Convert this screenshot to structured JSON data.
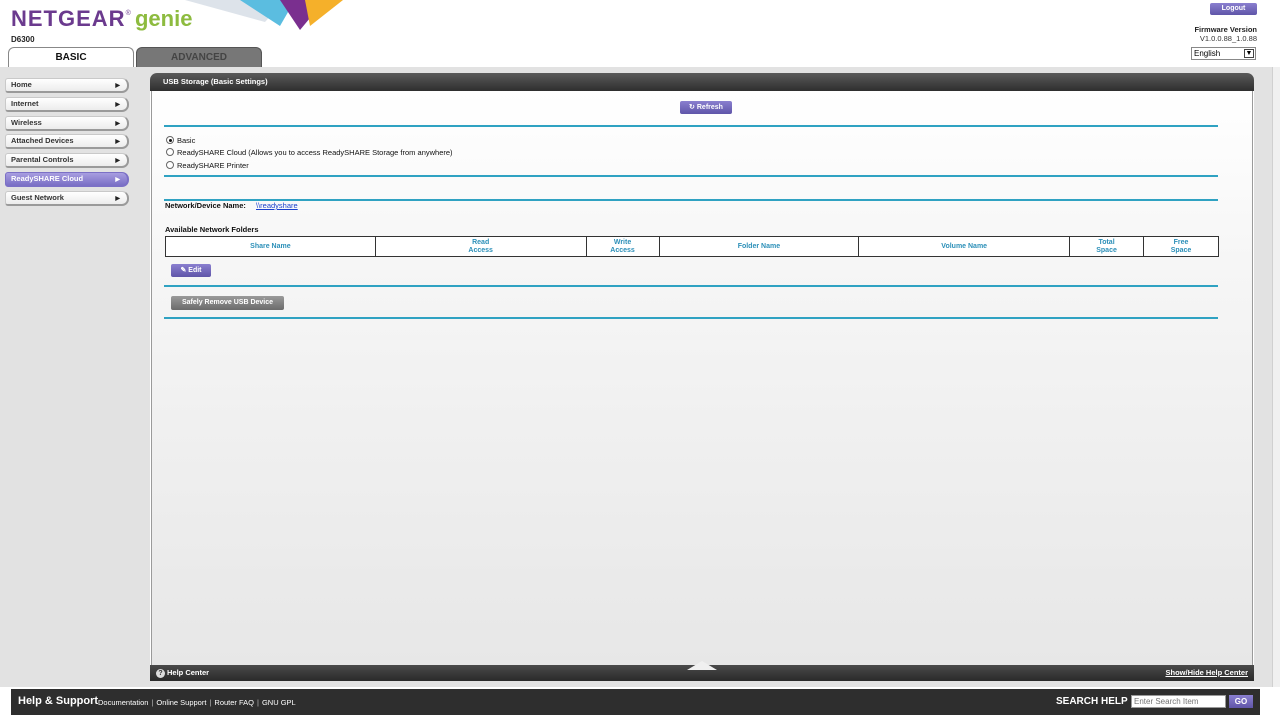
{
  "header": {
    "brand": "NETGEAR",
    "brand_mark": "®",
    "product": "genie",
    "model": "D6300",
    "tabs": [
      {
        "label": "BASIC",
        "active": true
      },
      {
        "label": "ADVANCED",
        "active": false
      }
    ],
    "logout_label": "Logout",
    "firmware_label": "Firmware Version",
    "firmware_value": "V1.0.0.88_1.0.88",
    "language": "English",
    "language_icon": "chevron-down-icon"
  },
  "sidebar": {
    "items": [
      {
        "label": "Home",
        "active": false
      },
      {
        "label": "Internet",
        "active": false
      },
      {
        "label": "Wireless",
        "active": false
      },
      {
        "label": "Attached Devices",
        "active": false
      },
      {
        "label": "Parental Controls",
        "active": false
      },
      {
        "label": "ReadySHARE Cloud",
        "active": true
      },
      {
        "label": "Guest Network",
        "active": false
      }
    ],
    "arrow_glyph": "▶"
  },
  "panel": {
    "title": "USB Storage (Basic Settings)",
    "refresh_label": "Refresh",
    "radio_options": [
      {
        "label": "Basic",
        "checked": true
      },
      {
        "label": "ReadySHARE Cloud (Allows you to access ReadySHARE Storage from anywhere)",
        "checked": false
      },
      {
        "label": "ReadySHARE Printer",
        "checked": false
      }
    ],
    "network_device_label": "Network/Device Name:",
    "network_device_value": "\\\\readyshare",
    "folders_title": "Available Network Folders",
    "table_headers": [
      [
        "Share Name"
      ],
      [
        "Read",
        "Access"
      ],
      [
        "Write",
        "Access"
      ],
      [
        "Folder Name"
      ],
      [
        "Volume Name"
      ],
      [
        "Total",
        "Space"
      ],
      [
        "Free",
        "Space"
      ]
    ],
    "edit_label": "Edit",
    "remove_label": "Safely Remove USB Device",
    "help_center_label": "Help Center",
    "show_hide_label": "Show/Hide Help Center"
  },
  "bottom_bar": {
    "title": "Help & Support",
    "links": [
      "Documentation",
      "Online Support",
      "Router FAQ",
      "GNU GPL"
    ],
    "search_label": "SEARCH HELP",
    "search_placeholder": "Enter Search Item",
    "go_label": "GO"
  },
  "colors": {
    "brand_purple": "#6b3a8e",
    "genie_green": "#8dbb3f",
    "button_purple": "#6f64b8",
    "divider_teal": "#2fa2c2",
    "header_text_teal": "#2b8fb8"
  }
}
